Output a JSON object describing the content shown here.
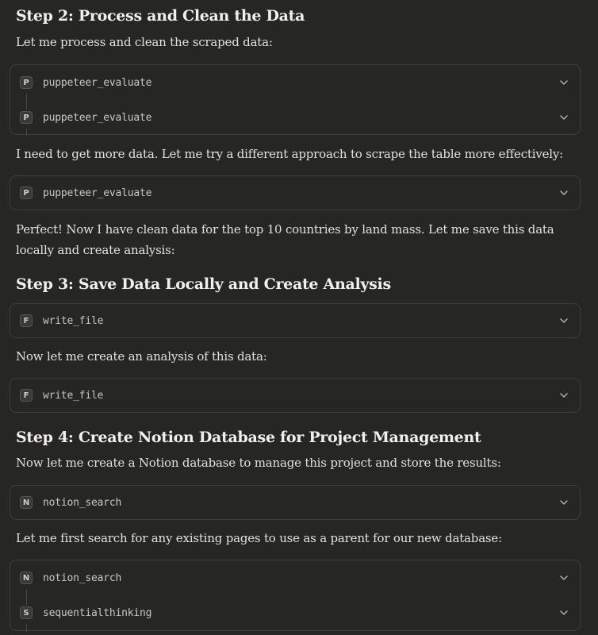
{
  "step2": {
    "heading": "Step 2: Process and Clean the Data",
    "intro": "Let me process and clean the scraped data:",
    "tools1": [
      {
        "badge": "P",
        "name": "puppeteer_evaluate",
        "icon": "chevron-down-icon"
      },
      {
        "badge": "P",
        "name": "puppeteer_evaluate",
        "icon": "chevron-down-icon"
      }
    ],
    "text2": "I need to get more data. Let me try a different approach to scrape the table more effectively:",
    "tools2": [
      {
        "badge": "P",
        "name": "puppeteer_evaluate",
        "icon": "chevron-down-icon"
      }
    ],
    "text3": "Perfect! Now I have clean data for the top 10 countries by land mass. Let me save this data locally and create analysis:"
  },
  "step3": {
    "heading": "Step 3: Save Data Locally and Create Analysis",
    "tools1": [
      {
        "badge": "F",
        "name": "write_file",
        "icon": "chevron-down-icon"
      }
    ],
    "text2": "Now let me create an analysis of this data:",
    "tools2": [
      {
        "badge": "F",
        "name": "write_file",
        "icon": "chevron-down-icon"
      }
    ]
  },
  "step4": {
    "heading": "Step 4: Create Notion Database for Project Management",
    "intro": "Now let me create a Notion database to manage this project and store the results:",
    "tools1": [
      {
        "badge": "N",
        "name": "notion_search",
        "icon": "chevron-down-icon"
      }
    ],
    "text2": "Let me first search for any existing pages to use as a parent for our new database:",
    "tools2": [
      {
        "badge": "N",
        "name": "notion_search",
        "icon": "chevron-down-icon"
      },
      {
        "badge": "S",
        "name": "sequentialthinking",
        "icon": "chevron-down-icon"
      }
    ]
  }
}
